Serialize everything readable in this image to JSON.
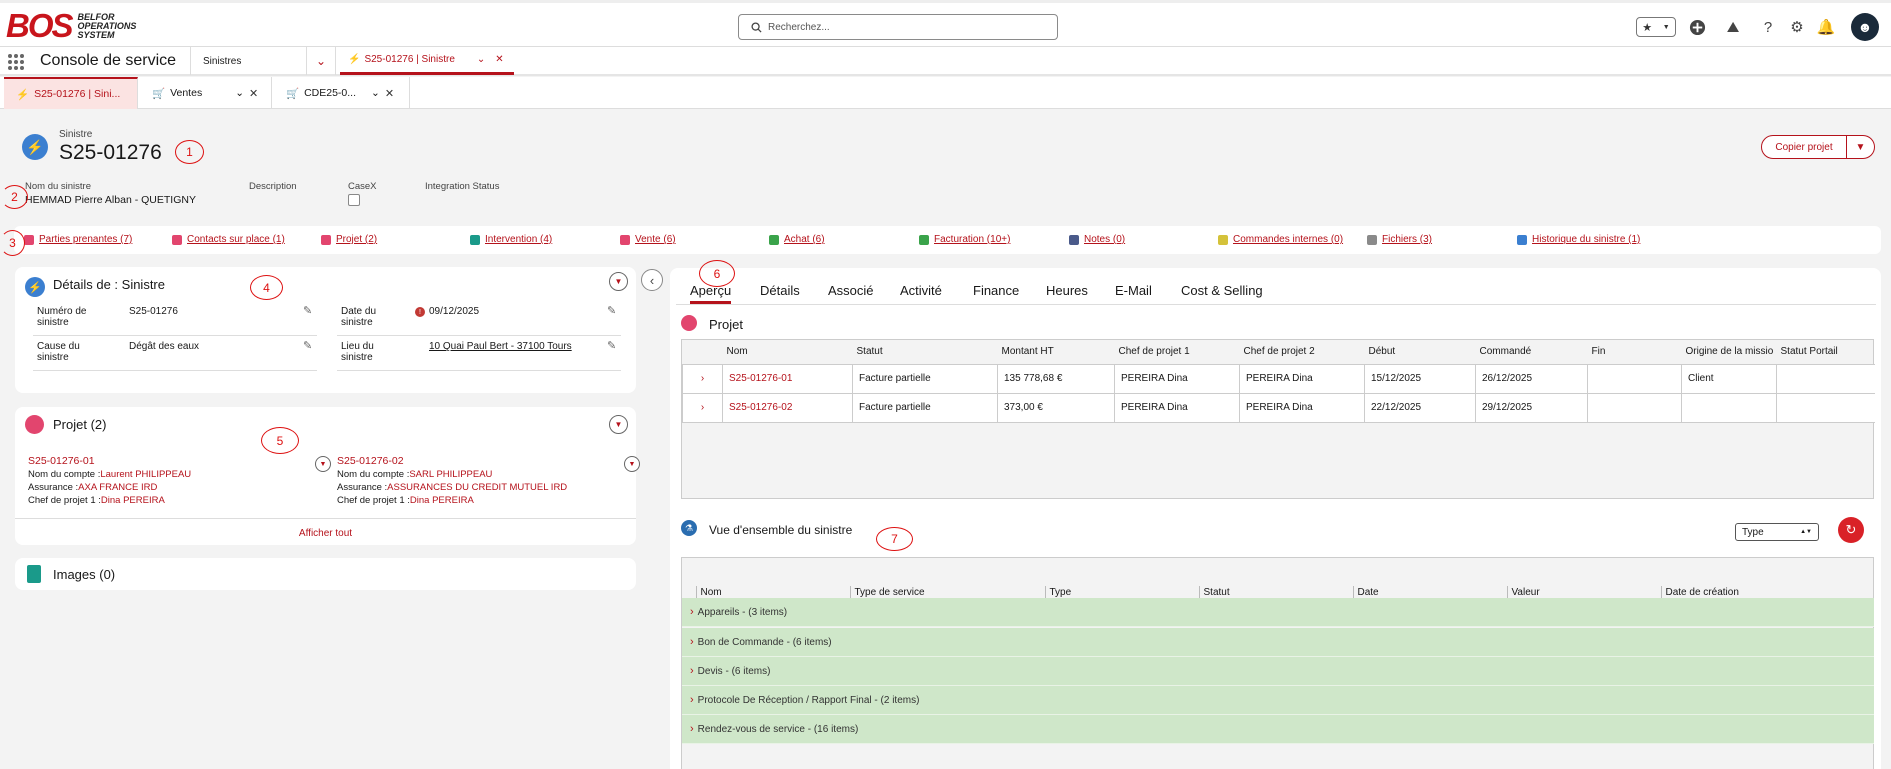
{
  "header": {
    "logo_mark": "BOS",
    "logo_text": [
      "BELFOR",
      "OPERATIONS",
      "SYSTEM"
    ],
    "search_placeholder": "Recherchez..."
  },
  "nav": {
    "app_name": "Console de service",
    "object_select": "Sinistres",
    "active_tab": "S25-01276 | Sinistre"
  },
  "subtabs": [
    {
      "label": "S25-01276 | Sini..."
    },
    {
      "label": "Ventes"
    },
    {
      "label": "CDE25-0..."
    }
  ],
  "record": {
    "type": "Sinistre",
    "title": "S25-01276",
    "copy_button": "Copier projet",
    "fields": [
      {
        "label": "Nom du sinistre",
        "value": "HEMMAD Pierre Alban - QUETIGNY"
      },
      {
        "label": "Description",
        "value": ""
      },
      {
        "label": "CaseX",
        "value": ""
      },
      {
        "label": "Integration Status",
        "value": ""
      }
    ]
  },
  "related": [
    {
      "label": "Parties prenantes (7)",
      "color": "#e2456e"
    },
    {
      "label": "Contacts sur place (1)",
      "color": "#e2456e"
    },
    {
      "label": "Projet (2)",
      "color": "#e2456e"
    },
    {
      "label": "Intervention (4)",
      "color": "#1a9a8a"
    },
    {
      "label": "Vente (6)",
      "color": "#e2456e"
    },
    {
      "label": "Achat (6)",
      "color": "#3aa34a"
    },
    {
      "label": "Facturation (10+)",
      "color": "#3aa34a"
    },
    {
      "label": "Notes (0)",
      "color": "#4a5a8a"
    },
    {
      "label": "Commandes internes (0)",
      "color": "#d4c23a"
    },
    {
      "label": "Fichiers (3)",
      "color": "#8a8a8a"
    },
    {
      "label": "Historique du sinistre (1)",
      "color": "#3b7fd0"
    }
  ],
  "details": {
    "title": "Détails de : Sinistre",
    "fields": [
      {
        "label": "Numéro de sinistre",
        "value": "S25-01276"
      },
      {
        "label": "Date du sinistre",
        "value": "09/12/2025"
      },
      {
        "label": "Cause du sinistre",
        "value": "Dégât des eaux"
      },
      {
        "label": "Lieu du sinistre",
        "value": "10 Quai Paul Bert - 37100 Tours"
      }
    ]
  },
  "projets_card": {
    "title": "Projet (2)",
    "items": [
      {
        "name": "S25-01276-01",
        "compte_label": "Nom du compte :",
        "compte": "Laurent PHILIPPEAU",
        "assurance_label": "Assurance :",
        "assurance": "AXA FRANCE IRD",
        "chef_label": "Chef de projet 1 :",
        "chef": "Dina PEREIRA"
      },
      {
        "name": "S25-01276-02",
        "compte_label": "Nom du compte :",
        "compte": "SARL PHILIPPEAU",
        "assurance_label": "Assurance :",
        "assurance": "ASSURANCES DU CREDIT MUTUEL IRD",
        "chef_label": "Chef de projet 1 :",
        "chef": "Dina PEREIRA"
      }
    ],
    "show_all": "Afficher tout"
  },
  "images_card": {
    "title": "Images (0)"
  },
  "right_tabs": [
    "Aperçu",
    "Détails",
    "Associé",
    "Activité",
    "Finance",
    "Heures",
    "E-Mail",
    "Cost & Selling"
  ],
  "projet_section": {
    "title": "Projet",
    "columns": [
      "Nom",
      "Statut",
      "Montant HT",
      "Chef de projet 1",
      "Chef de projet 2",
      "Début",
      "Commandé",
      "Fin",
      "Origine de la missio",
      "Statut Portail"
    ],
    "rows": [
      [
        "S25-01276-01",
        "Facture partielle",
        "135 778,68 €",
        "PEREIRA Dina",
        "PEREIRA Dina",
        "15/12/2025",
        "26/12/2025",
        "",
        "Client",
        ""
      ],
      [
        "S25-01276-02",
        "Facture partielle",
        "373,00 €",
        "PEREIRA Dina",
        "PEREIRA Dina",
        "22/12/2025",
        "29/12/2025",
        "",
        "",
        ""
      ]
    ]
  },
  "overview": {
    "title": "Vue d'ensemble du sinistre",
    "type_select": "Type",
    "columns": [
      "Nom",
      "Type de service",
      "Type",
      "Statut",
      "Date",
      "Valeur",
      "Date de création"
    ],
    "groups": [
      "Appareils - (3 items)",
      "Bon de Commande - (6 items)",
      "Devis - (6 items)",
      "Protocole De Réception / Rapport Final - (2 items)",
      "Rendez-vous de service - (16 items)"
    ]
  },
  "annotations": [
    "1",
    "2",
    "3",
    "4",
    "5",
    "6",
    "7"
  ]
}
